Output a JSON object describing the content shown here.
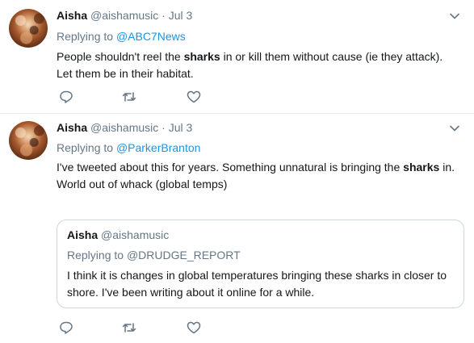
{
  "tweets": [
    {
      "name": "Aisha",
      "handle": "@aishamusic",
      "separator": "·",
      "time": "Jul 3",
      "replying_prefix": "Replying to",
      "replying_to": "@ABC7News",
      "text_before": "People shouldn't reel the ",
      "text_bold": "sharks",
      "text_after": " in or kill them without cause (ie they attack). Let them be in their habitat.",
      "avatar_icon": "user-avatar"
    },
    {
      "name": "Aisha",
      "handle": "@aishamusic",
      "separator": "·",
      "time": "Jul 3",
      "replying_prefix": "Replying to",
      "replying_to": "@ParkerBranton",
      "text_before": "I've tweeted about this for years. Something unnatural is bringing the ",
      "text_bold": "sharks",
      "text_after": " in. World out of whack (global temps)",
      "avatar_icon": "user-avatar",
      "quote": {
        "name": "Aisha",
        "handle": "@aishamusic",
        "replying_prefix": "Replying to",
        "replying_to": "@DRUDGE_REPORT",
        "text": "I think it is changes in global temperatures bringing these sharks in closer to shore. I've been writing about it online for a while."
      }
    }
  ],
  "icons": {
    "reply": "reply-icon",
    "retweet": "retweet-icon",
    "like": "heart-icon",
    "caret": "chevron-down-icon"
  },
  "colors": {
    "link": "#1b95e0",
    "secondary_text": "#657786",
    "divider": "#e6ecf0"
  }
}
